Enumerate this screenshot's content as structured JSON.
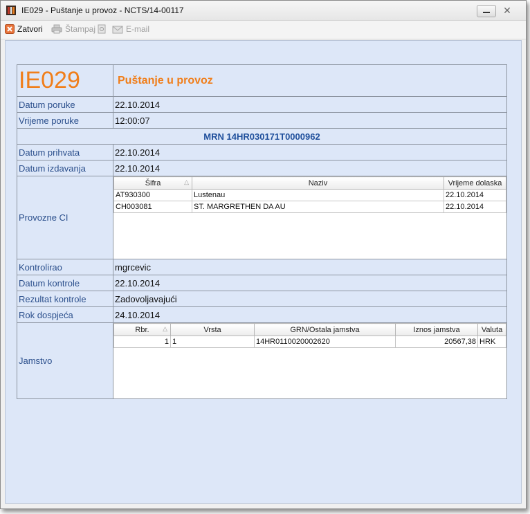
{
  "window": {
    "title": "IE029 - Puštanje u provoz - NCTS/14-00117",
    "close_glyph": "✕"
  },
  "toolbar": {
    "close_label": "Zatvori",
    "print_label": "Štampaj",
    "email_label": "E-mail"
  },
  "form": {
    "code": "IE029",
    "title": "Puštanje u provoz",
    "fields": {
      "datum_poruke_label": "Datum poruke",
      "datum_poruke": "22.10.2014",
      "vrijeme_poruke_label": "Vrijeme poruke",
      "vrijeme_poruke": "12:00:07",
      "mrn": "MRN 14HR030171T0000962",
      "datum_prihvata_label": "Datum prihvata",
      "datum_prihvata": "22.10.2014",
      "datum_izdavanja_label": "Datum izdavanja",
      "datum_izdavanja": "22.10.2014",
      "provozne_label": "Provozne CI",
      "kontrolirao_label": "Kontrolirao",
      "kontrolirao": "mgrcevic",
      "datum_kontrole_label": "Datum kontrole",
      "datum_kontrole": "22.10.2014",
      "rezultat_kontrole_label": "Rezultat kontrole",
      "rezultat_kontrole": "Zadovoljavajući",
      "rok_dospjeca_label": "Rok dospjeća",
      "rok_dospjeca": "24.10.2014",
      "jamstvo_label": "Jamstvo"
    },
    "provozne_grid": {
      "columns": [
        "Šifra",
        "Naziv",
        "Vrijeme dolaska"
      ],
      "rows": [
        [
          "AT930300",
          "Lustenau",
          "22.10.2014"
        ],
        [
          "CH003081",
          "ST. MARGRETHEN DA AU",
          "22.10.2014"
        ]
      ]
    },
    "jamstvo_grid": {
      "columns": [
        "Rbr.",
        "Vrsta",
        "GRN/Ostala jamstva",
        "Iznos jamstva",
        "Valuta"
      ],
      "rows": [
        [
          "1",
          "1",
          "14HR0110020002620",
          "20567,38",
          "HRK"
        ]
      ]
    }
  }
}
